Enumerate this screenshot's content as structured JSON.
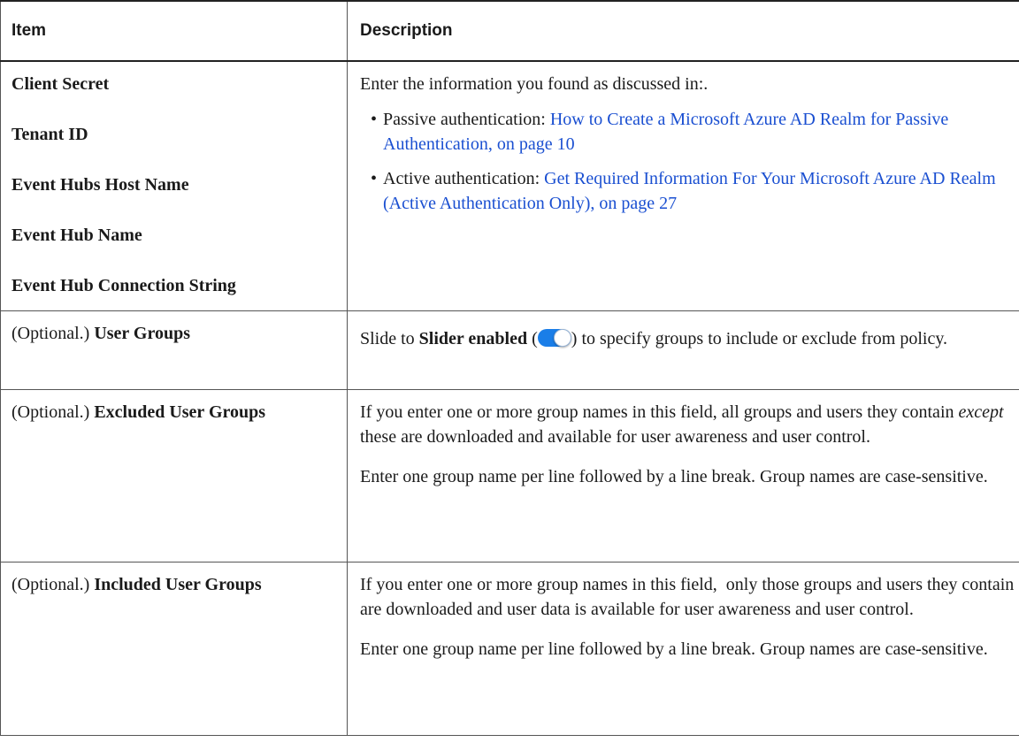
{
  "header": {
    "item": "Item",
    "description": "Description"
  },
  "rows": {
    "credentials": {
      "fields": [
        "Client Secret",
        "Tenant ID",
        "Event Hubs Host Name",
        "Event Hub Name",
        "Event Hub Connection String"
      ],
      "intro": "Enter the information you found as discussed in:.",
      "bullets": [
        {
          "prefix": "Passive authentication: ",
          "link": "How to Create a Microsoft Azure AD Realm for Passive Authentication, on page 10"
        },
        {
          "prefix": "Active authentication: ",
          "link": "Get Required Information For Your Microsoft Azure AD Realm (Active Authentication Only), on page 27"
        }
      ]
    },
    "user_groups": {
      "optional": "(Optional.)",
      "label": "User Groups",
      "desc_pre": "Slide to ",
      "desc_bold": "Slider enabled",
      "desc_open": " (",
      "desc_post": ") to specify groups to include or exclude from policy."
    },
    "excluded": {
      "optional": "(Optional.)",
      "label": "Excluded User Groups",
      "p1_pre": "If you enter one or more group names in this field, all groups and users they contain ",
      "p1_em": "except",
      "p1_post": " these are downloaded and available for user awareness and user control.",
      "p2": "Enter one group name per line followed by a line break. Group names are case-sensitive."
    },
    "included": {
      "optional": "(Optional.)",
      "label": "Included User Groups",
      "p1": "If you enter one or more group names in this field,  only those groups and users they contain are downloaded and user data is available for user awareness and user control.",
      "p2": "Enter one group name per line followed by a line break. Group names are case-sensitive."
    }
  },
  "icons": {
    "toggle": "toggle-switch-on-icon",
    "toggle_color": "#1a7ee8",
    "link_color": "#1a4fd1"
  }
}
